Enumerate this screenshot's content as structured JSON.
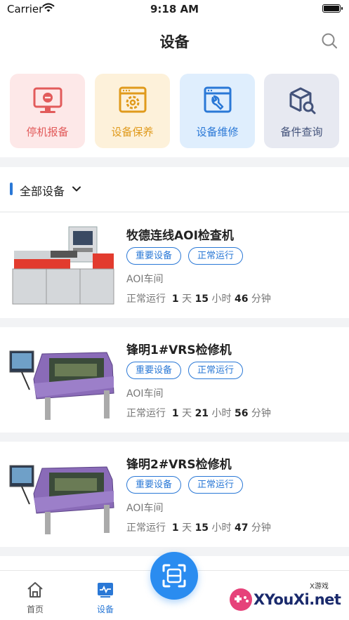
{
  "status": {
    "carrier": "Carrier",
    "time": "9:18 AM"
  },
  "nav": {
    "title": "设备"
  },
  "quick_actions": [
    {
      "label": "停机报备",
      "icon": "monitor-stop-icon",
      "color": "#e25b5b"
    },
    {
      "label": "设备保养",
      "icon": "gear-window-icon",
      "color": "#e09a1c"
    },
    {
      "label": "设备维修",
      "icon": "wrench-window-icon",
      "color": "#2a78d6"
    },
    {
      "label": "备件查询",
      "icon": "box-search-icon",
      "color": "#43527a"
    }
  ],
  "filter": {
    "label": "全部设备"
  },
  "devices": [
    {
      "name": "牧德连线AOI检查机",
      "tag1": "重要设备",
      "tag2": "正常运行",
      "location": "AOI车间",
      "status": "正常运行",
      "days": "1",
      "day_unit": "天",
      "hours": "15",
      "hour_unit": "小时",
      "minutes": "46",
      "minute_unit": "分钟"
    },
    {
      "name": "锋明1#VRS检修机",
      "tag1": "重要设备",
      "tag2": "正常运行",
      "location": "AOI车间",
      "status": "正常运行",
      "days": "1",
      "day_unit": "天",
      "hours": "21",
      "hour_unit": "小时",
      "minutes": "56",
      "minute_unit": "分钟"
    },
    {
      "name": "锋明2#VRS检修机",
      "tag1": "重要设备",
      "tag2": "正常运行",
      "location": "AOI车间",
      "status": "正常运行",
      "days": "1",
      "day_unit": "天",
      "hours": "15",
      "hour_unit": "小时",
      "minutes": "47",
      "minute_unit": "分钟"
    }
  ],
  "tabbar": {
    "home": "首页",
    "device": "设备"
  },
  "watermark": {
    "text": "XYouXi.net",
    "small": "X游戏"
  },
  "colors": {
    "accent": "#2a78d6",
    "scan": "#2a8cf0"
  }
}
